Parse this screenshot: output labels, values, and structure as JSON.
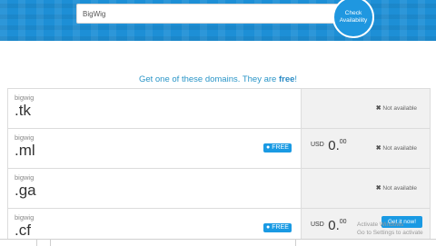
{
  "search": {
    "value": "BigWig"
  },
  "check_button": {
    "label_line1": "Check",
    "label_line2": "Availability"
  },
  "headline": {
    "prefix": "Get one of these domains. They are ",
    "emphasis": "free",
    "suffix": "!"
  },
  "rows": [
    {
      "name": "bigwig",
      "tld": ".tk",
      "free_badge": "",
      "currency": "",
      "amount": "",
      "cents": "",
      "status": "Not available"
    },
    {
      "name": "bigwig",
      "tld": ".ml",
      "free_badge": "FREE",
      "currency": "USD",
      "amount": "0.",
      "cents": "00",
      "status": "Not available"
    },
    {
      "name": "bigwig",
      "tld": ".ga",
      "free_badge": "",
      "currency": "",
      "amount": "",
      "cents": "",
      "status": "Not available"
    },
    {
      "name": "bigwig",
      "tld": ".cf",
      "free_badge": "FREE",
      "currency": "USD",
      "amount": "0.",
      "cents": "00",
      "status": ""
    }
  ],
  "get_it_button": {
    "label": "Get it now!"
  },
  "watermark": {
    "line1": "Activate Windows",
    "line2": "Go to Settings to activate"
  }
}
